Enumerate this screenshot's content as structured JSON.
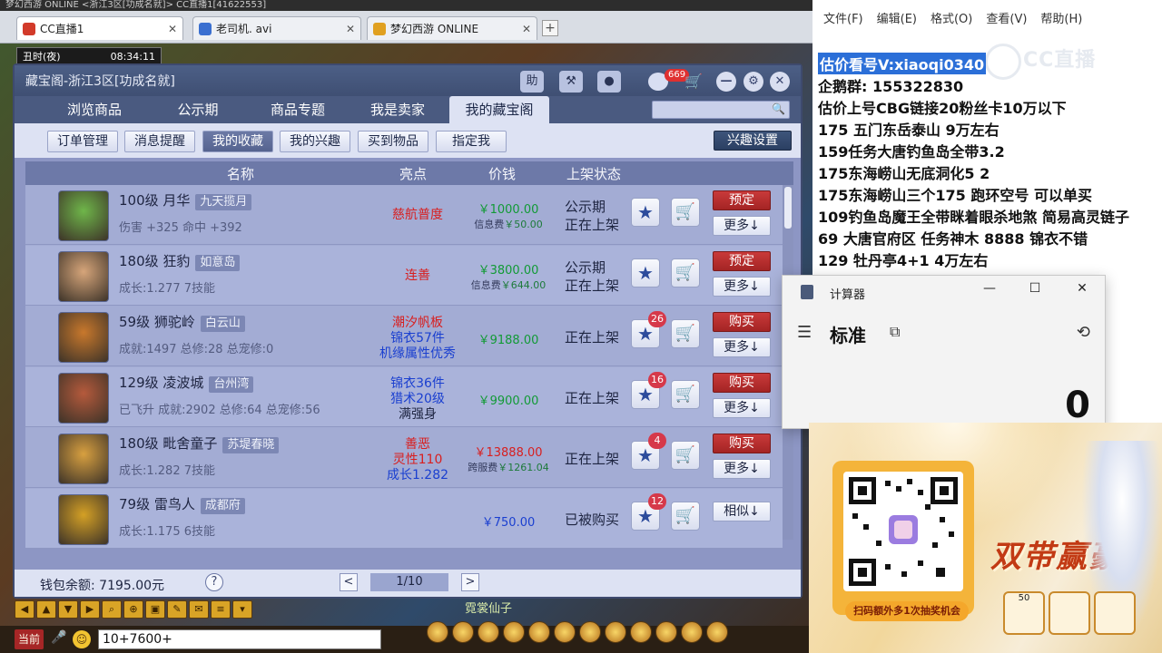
{
  "browser": {
    "top_strip": "梦幻西游 ONLINE  <浙江3区[功成名就]>  CC直播1[41622553]",
    "tabs": [
      {
        "label": "CC直播1",
        "color": "#d23a2a"
      },
      {
        "label": "老司机. avi",
        "color": "#3a6fd0"
      },
      {
        "label": "梦幻西游 ONLINE",
        "color": "#e0a020"
      }
    ],
    "add_tab": "+"
  },
  "game": {
    "time_label": "丑时(夜)",
    "time_value": "08:34:11",
    "npc_label": "霓裳仙子",
    "chat_channel": "当前",
    "chat_input": "10+7600+"
  },
  "treasure": {
    "title": "藏宝阁-浙江3区[功成名就]",
    "cart_count": "669",
    "help_icon": "助",
    "nav_tabs": [
      "浏览商品",
      "公示期",
      "商品专题",
      "我是卖家",
      "我的藏宝阁"
    ],
    "sub_tabs": [
      "订单管理",
      "消息提醒",
      "我的收藏",
      "我的兴趣",
      "买到物品",
      "指定我"
    ],
    "interest_settings": "兴趣设置",
    "columns": {
      "name": "名称",
      "highlight": "亮点",
      "price": "价钱",
      "status": "上架状态"
    },
    "rows": [
      {
        "level_name": "100级  月华",
        "server": "九天揽月",
        "stats": "伤害 +325  命中 +392",
        "highlights": [
          {
            "text": "慈航普度",
            "color": "#d81f1f"
          }
        ],
        "price": "￥1000.00",
        "fee_label": "信息费",
        "fee": "￥50.00",
        "status": [
          "公示期",
          "正在上架"
        ],
        "badge": "",
        "action": "预定",
        "more": "更多↓"
      },
      {
        "level_name": "180级  狂豹",
        "server": "如意岛",
        "stats": "成长:1.277  7技能",
        "highlights": [
          {
            "text": "连善",
            "color": "#d81f1f"
          }
        ],
        "price": "￥3800.00",
        "fee_label": "信息费",
        "fee": "￥644.00",
        "status": [
          "公示期",
          "正在上架"
        ],
        "badge": "",
        "action": "预定",
        "more": "更多↓"
      },
      {
        "level_name": "59级  狮驼岭",
        "server": "白云山",
        "stats": "成就:1497  总修:28  总宠修:0",
        "highlights": [
          {
            "text": "潮汐帆板",
            "color": "#d81f1f"
          },
          {
            "text": "锦衣57件",
            "color": "#1a3fd0"
          },
          {
            "text": "机缘属性优秀",
            "color": "#1a3fd0"
          }
        ],
        "price": "￥9188.00",
        "fee_label": "",
        "fee": "",
        "status": [
          "正在上架"
        ],
        "badge": "26",
        "action": "购买",
        "more": "更多↓"
      },
      {
        "level_name": "129级  凌波城",
        "server": "台州湾",
        "stats": "已飞升  成就:2902  总修:64  总宠修:56",
        "highlights": [
          {
            "text": "锦衣36件",
            "color": "#1a3fd0"
          },
          {
            "text": "猎术20级",
            "color": "#1a3fd0"
          },
          {
            "text": "满强身",
            "color": "#1d2440"
          }
        ],
        "price": "￥9900.00",
        "fee_label": "",
        "fee": "",
        "status": [
          "正在上架"
        ],
        "badge": "16",
        "action": "购买",
        "more": "更多↓"
      },
      {
        "level_name": "180级  毗舍童子",
        "server": "苏堤春晓",
        "stats": "成长:1.282  7技能",
        "highlights": [
          {
            "text": "善恶",
            "color": "#d81f1f"
          },
          {
            "text": "灵性110",
            "color": "#d81f1f"
          },
          {
            "text": "成长1.282",
            "color": "#1a3fd0"
          }
        ],
        "price": "￥13888.00",
        "fee_label": "跨服费",
        "fee": "￥1261.04",
        "status": [
          "正在上架"
        ],
        "badge": "4",
        "action": "购买",
        "more": "更多↓",
        "price_color": "#d81f1f"
      },
      {
        "level_name": "79级  雷鸟人",
        "server": "成都府",
        "stats": "成长:1.175  6技能",
        "highlights": [],
        "price": "￥750.00",
        "fee_label": "",
        "fee": "",
        "status": [
          "已被购买"
        ],
        "badge": "12",
        "action": "",
        "more": "相似↓",
        "price_color": "#1a3fd0"
      }
    ],
    "wallet": "钱包余额: 7195.00元",
    "help": "?",
    "prev": "<",
    "page": "1/10",
    "next": ">"
  },
  "notepad": {
    "menu": [
      "文件(F)",
      "编辑(E)",
      "格式(O)",
      "查看(V)",
      "帮助(H)"
    ],
    "lines": [
      "估价看号V:xiaoqi0340",
      "企鹅群:  155322830",
      "估价上号CBG链接20粉丝卡10万以下",
      "175 五门东岳泰山  9万左右",
      "159任务大唐钓鱼岛全带3.2",
      "175东海崂山无底洞化5  2",
      "175东海崂山三个175 跑环空号 可以单买",
      "109钓鱼岛魔王全带眯着眼杀地煞 简易高灵链子",
      "69  大唐官府区 任务神木 8888 锦衣不错",
      "129 牡丹亭4+1 4万左右"
    ],
    "watermark": "CC直播"
  },
  "calculator": {
    "title": "计算器",
    "mode": "标准",
    "display": "0",
    "minimize": "—",
    "maximize": "☐",
    "close": "✕"
  },
  "promo": {
    "title": "双带赢豪",
    "qr_label": "扫码额外多1次抽奖机会",
    "prizes": [
      "50",
      "",
      ""
    ]
  }
}
